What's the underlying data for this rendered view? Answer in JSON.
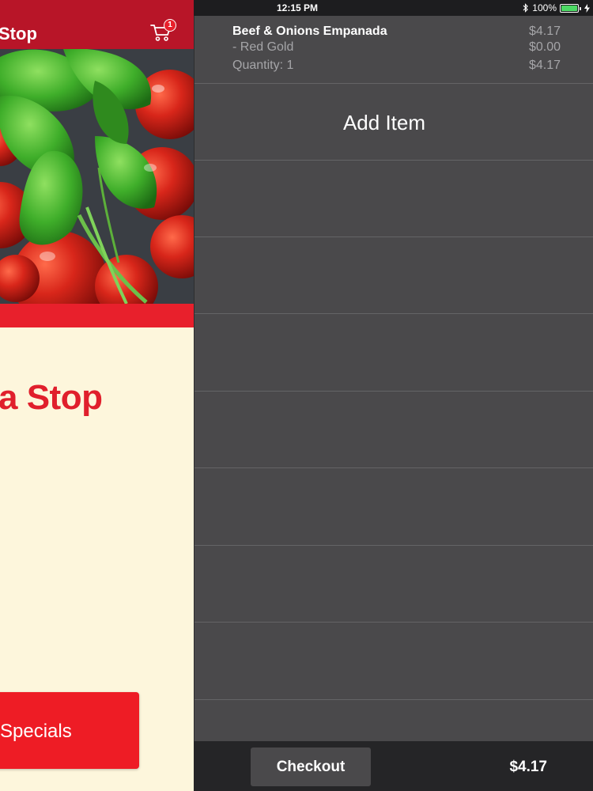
{
  "app": {
    "title_visible": "Stop",
    "brand_visible": "a Stop",
    "cart_badge_count": "1",
    "specials_button_label": "Specials",
    "colors": {
      "header_red": "#b81528",
      "brand_red": "#e01f2c",
      "button_red": "#ee1c25",
      "cream": "#fdf6dc"
    }
  },
  "status_bar": {
    "time": "12:15 PM",
    "battery_percent": "100%",
    "icons": [
      "bluetooth-icon",
      "battery-icon",
      "charging-icon"
    ]
  },
  "cart": {
    "items": [
      {
        "name": "Beef & Onions Empanada",
        "price": "$4.17",
        "modifier": " - Red Gold",
        "modifier_price": "$0.00",
        "quantity_label": "Quantity: 1",
        "line_total": "$4.17"
      }
    ],
    "add_item_label": "Add Item",
    "checkout_label": "Checkout",
    "total": "$4.17",
    "colors": {
      "drawer_bg": "#4a494b",
      "footer_bg": "#252527",
      "divider": "#646466",
      "muted_text": "#a5a5a8"
    }
  }
}
